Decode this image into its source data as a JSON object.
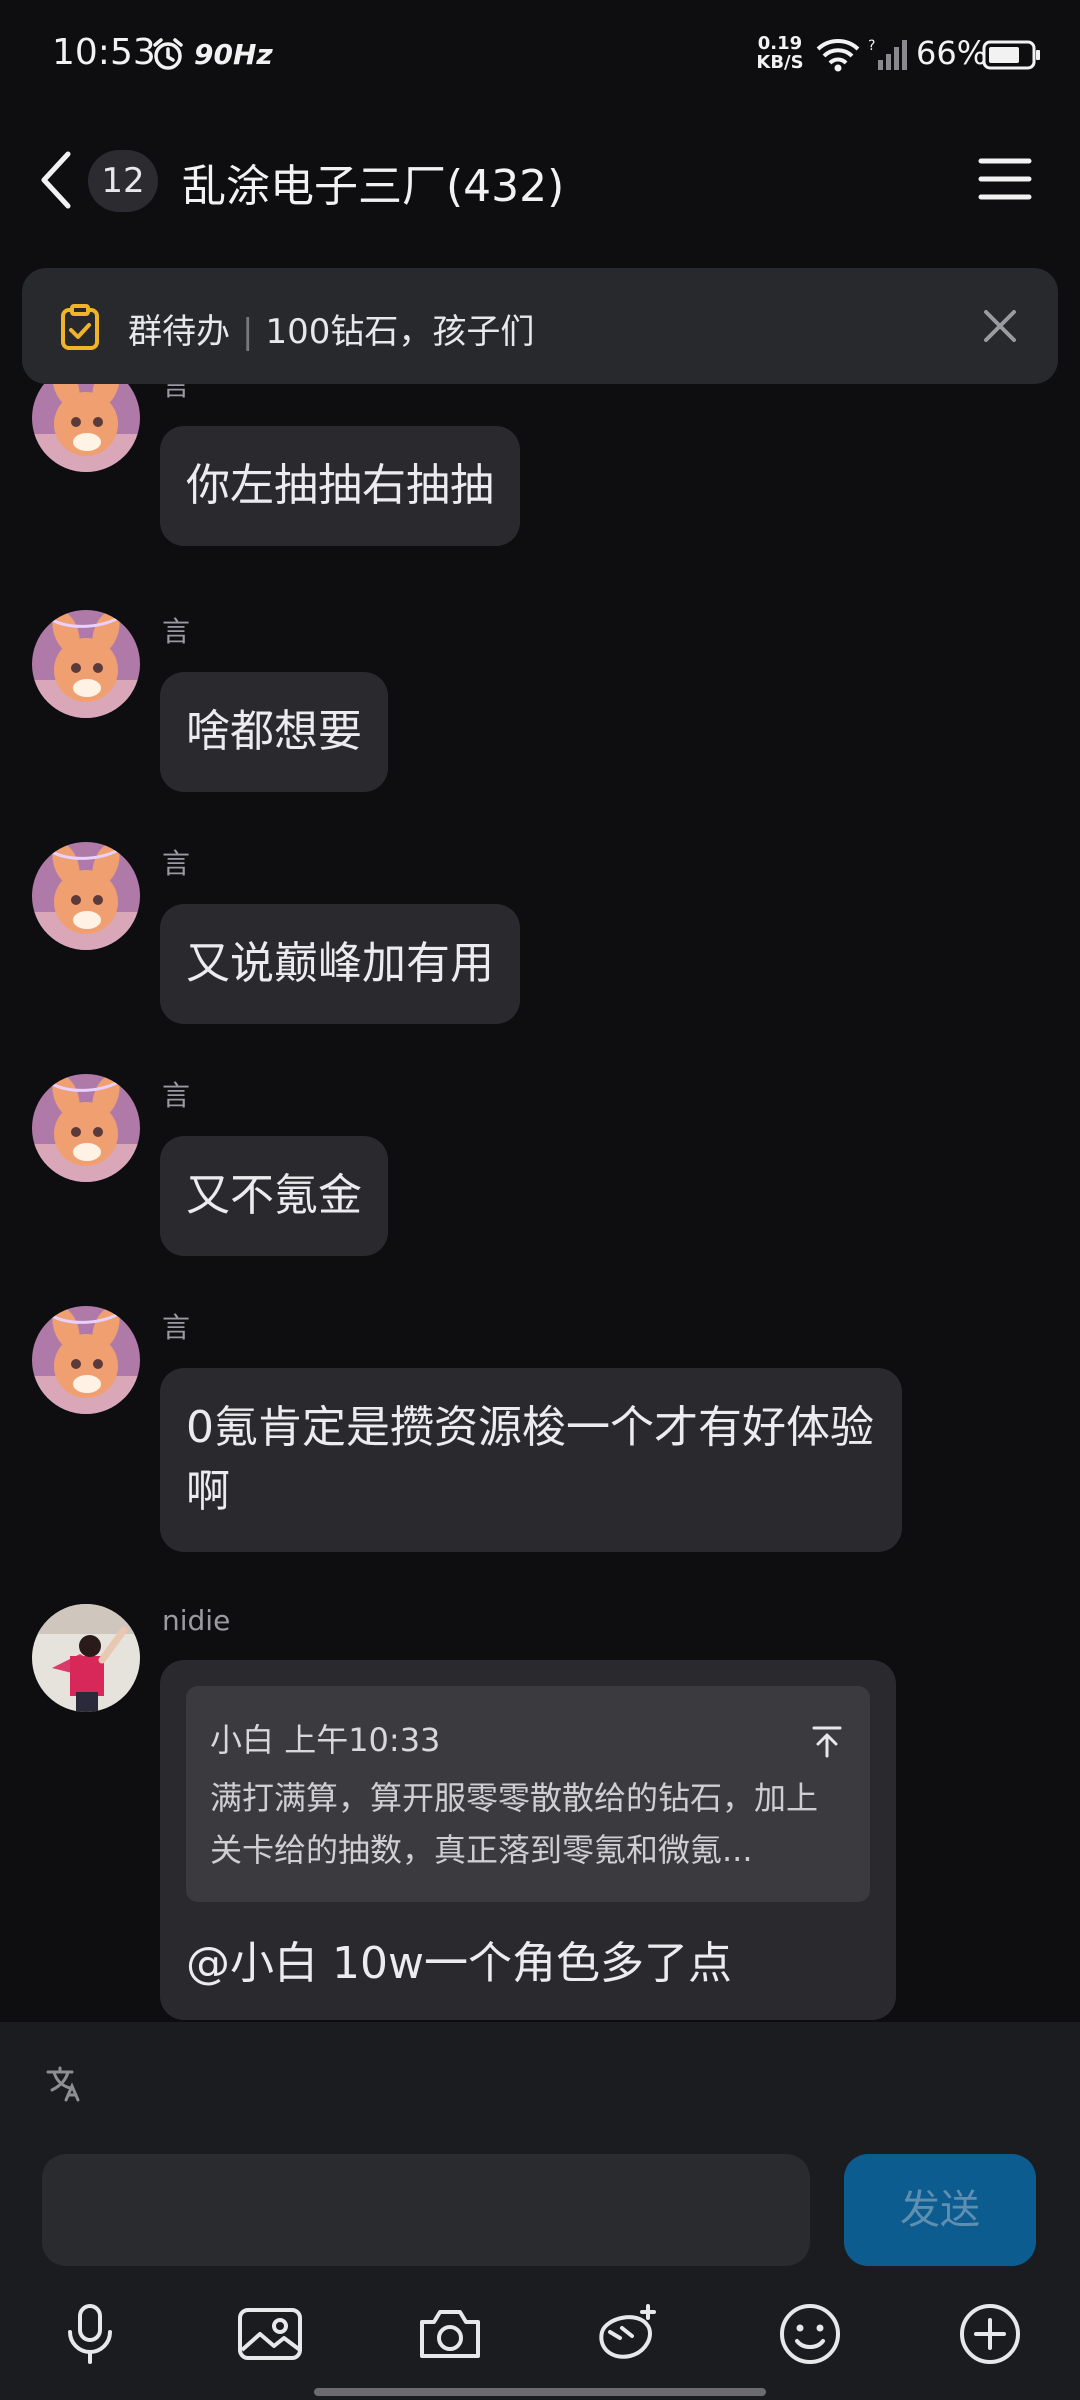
{
  "status_bar": {
    "time": "10:53",
    "refresh_rate": "90Hz",
    "net_speed_value": "0.19",
    "net_speed_unit": "KB/S",
    "battery": "66%"
  },
  "header": {
    "unread_count": "12",
    "title": "乱涂电子三厂(432)"
  },
  "pinned": {
    "label": "群待办",
    "text": "100钻石，孩子们"
  },
  "messages": [
    {
      "sender": "言",
      "text": "你左抽抽右抽抽"
    },
    {
      "sender": "言",
      "text": "啥都想要"
    },
    {
      "sender": "言",
      "text": "又说巅峰加有用"
    },
    {
      "sender": "言",
      "text": "又不氪金"
    },
    {
      "sender": "言",
      "text": "0氪肯定是攒资源梭一个才有好体验啊"
    },
    {
      "sender": "nidie",
      "quote": {
        "author": "小白",
        "time": "上午10:33",
        "text": "满打满算，算开服零零散散给的钻石，加上关卡给的抽数，真正落到零氪和微氪..."
      },
      "text": "@小白 10w一个角色多了点"
    }
  ],
  "composer": {
    "input_value": "",
    "send_label": "发送"
  },
  "icons": {
    "toolbar": [
      "microphone-icon",
      "image-icon",
      "camera-icon",
      "sticker-icon",
      "emoji-icon",
      "plus-icon"
    ]
  },
  "colors": {
    "background": "#0e0e10",
    "bubble": "#2a2a2e",
    "send_button": "#0d5c8f",
    "todo_icon": "#f0b429"
  }
}
